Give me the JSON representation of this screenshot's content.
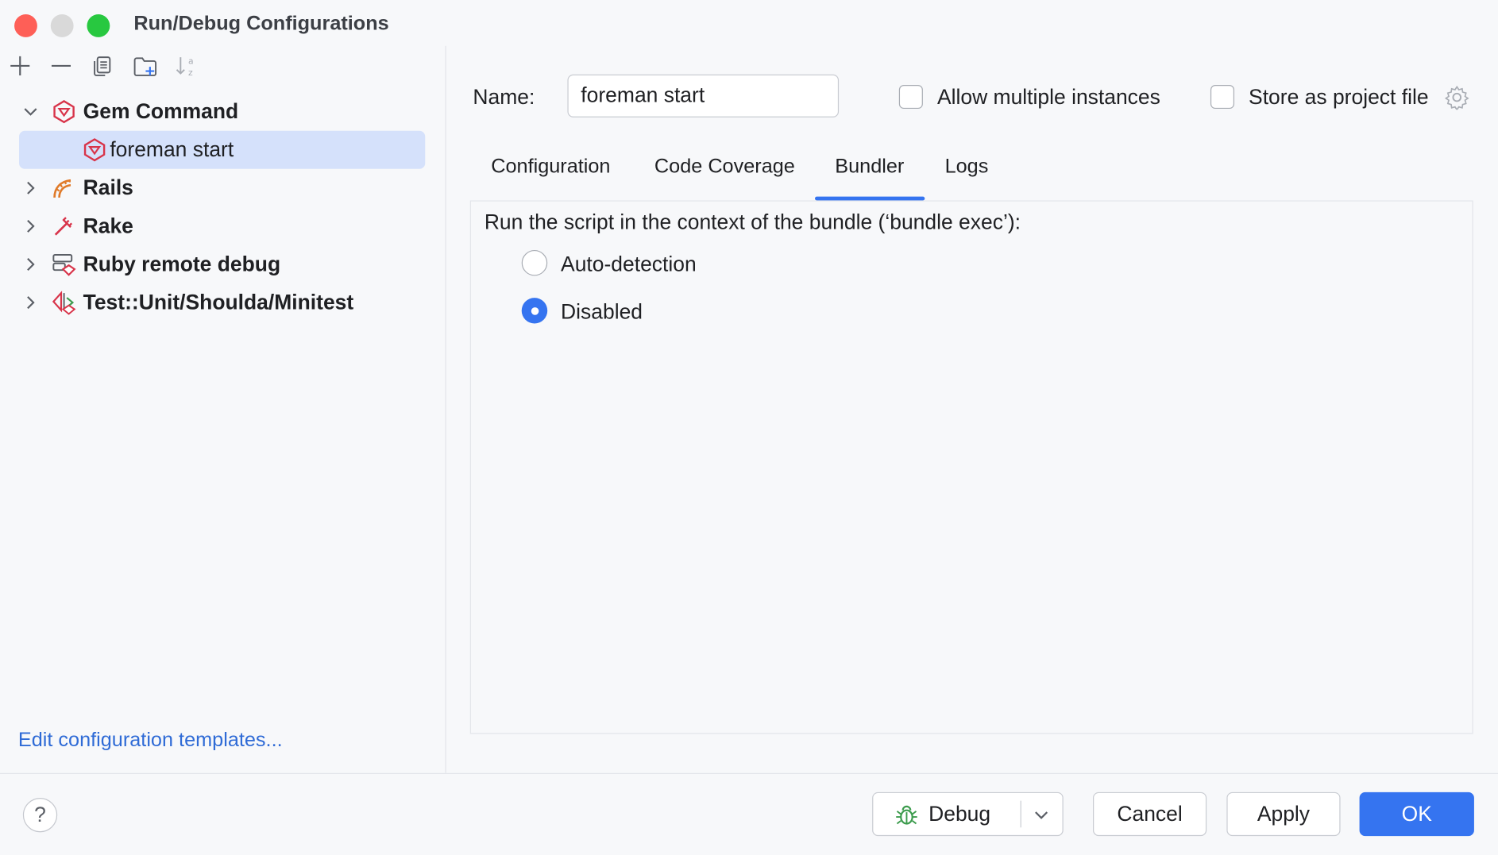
{
  "window": {
    "title": "Run/Debug Configurations"
  },
  "toolbar": {
    "icons": [
      "add-icon",
      "remove-icon",
      "copy-icon",
      "new-folder-icon",
      "sort-alpha-icon"
    ]
  },
  "tree": {
    "items": [
      {
        "label": "Gem Command",
        "icon": "gem-icon",
        "expanded": true,
        "bold": true
      },
      {
        "label": "foreman start",
        "icon": "gem-icon",
        "selected": true
      },
      {
        "label": "Rails",
        "icon": "rails-icon",
        "expanded": false,
        "bold": true
      },
      {
        "label": "Rake",
        "icon": "rake-icon",
        "expanded": false,
        "bold": true
      },
      {
        "label": "Ruby remote debug",
        "icon": "remote-debug-icon",
        "expanded": false,
        "bold": true
      },
      {
        "label": "Test::Unit/Shoulda/Minitest",
        "icon": "test-icon",
        "expanded": false,
        "bold": true
      }
    ]
  },
  "left_footer": {
    "link": "Edit configuration templates..."
  },
  "form": {
    "name_label": "Name:",
    "name_value": "foreman start",
    "allow_multiple": {
      "label": "Allow multiple instances",
      "checked": false
    },
    "store_as_project": {
      "label": "Store as project file",
      "checked": false
    }
  },
  "tabs": {
    "items": [
      "Configuration",
      "Code Coverage",
      "Bundler",
      "Logs"
    ],
    "active": "Bundler"
  },
  "bundler": {
    "description": "Run the script in the context of the bundle (‘bundle exec’):",
    "options": [
      {
        "label": "Auto-detection",
        "selected": false
      },
      {
        "label": "Disabled",
        "selected": true
      }
    ]
  },
  "footer": {
    "help": "?",
    "debug_label": "Debug",
    "cancel_label": "Cancel",
    "apply_label": "Apply",
    "ok_label": "OK"
  },
  "colors": {
    "accent": "#3574f0",
    "selection": "#d5e1fb",
    "link": "#2f6bd6",
    "close": "#fe5f57",
    "minimize": "#d9d9d9",
    "maximize": "#28c840"
  }
}
